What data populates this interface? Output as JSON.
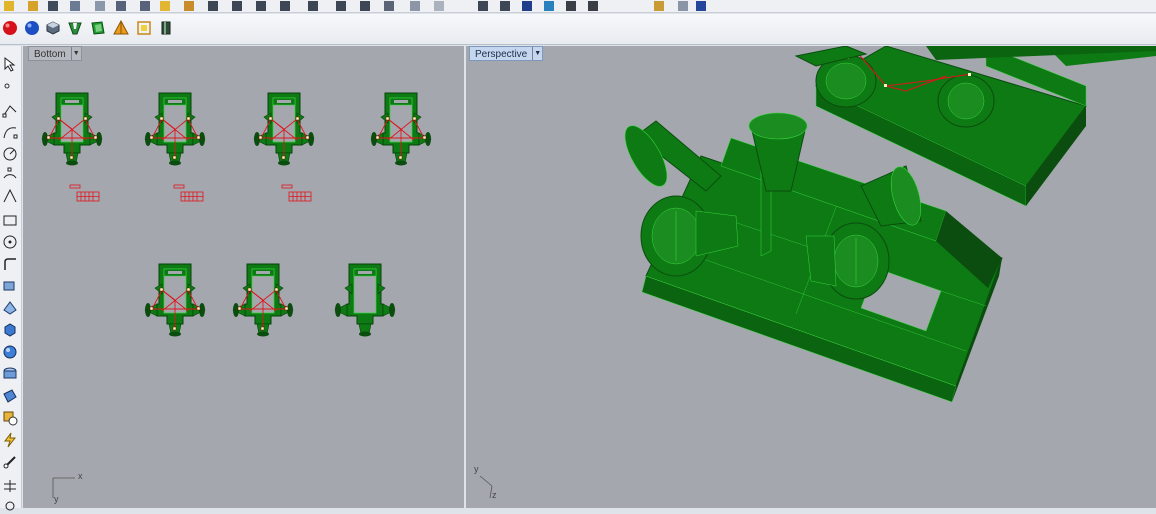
{
  "toolbar_top": {
    "icons": [
      "select-icon",
      "window-select-icon",
      "cut-icon",
      "copy-icon",
      "paste-icon",
      "undo-icon",
      "redo-icon",
      "pan-icon",
      "rotate-view-icon",
      "zoom-icon",
      "zoom-window-icon",
      "zoom-extents-icon",
      "zoom-selected-icon",
      "set-view-icon",
      "camera-icon",
      "layer-icon",
      "properties-icon",
      "render-sphere-icon",
      "render-icon",
      "material-icon",
      "light-icon",
      "environment-icon",
      "options-icon",
      "help-icon"
    ]
  },
  "toolbar_main": {
    "icons": [
      "render-preview-icon",
      "material-editor-icon",
      "environment-editor-icon",
      "ground-plane-icon",
      "render-settings-icon",
      "lights-icon",
      "sun-icon"
    ]
  },
  "left_tools": {
    "icons": [
      "select-icon",
      "point-icon",
      "polyline-icon",
      "curve-icon",
      "circle-icon",
      "arc-icon",
      "ellipse-icon",
      "rectangle-icon",
      "polygon-icon",
      "fillet-icon",
      "offset-icon",
      "extrude-icon",
      "surface-icon",
      "solid-box-icon",
      "sphere-icon",
      "mesh-icon",
      "boolean-icon",
      "transform-icon",
      "array-icon",
      "explode-icon",
      "trim-icon",
      "split-icon",
      "dimension-icon"
    ]
  },
  "viewports": {
    "bottom": {
      "label": "Bottom",
      "axis_x": "x",
      "axis_y": "y"
    },
    "perspective": {
      "label": "Perspective",
      "axis_y": "y",
      "axis_z": "z"
    }
  },
  "colors": {
    "model_green": "#0e7a14",
    "model_dark": "#0a4d0e",
    "model_line": "#37d33c",
    "curve_red": "#e0141b",
    "viewport_bg": "#a4a8ae",
    "active_tab": "#c4d7ee"
  }
}
